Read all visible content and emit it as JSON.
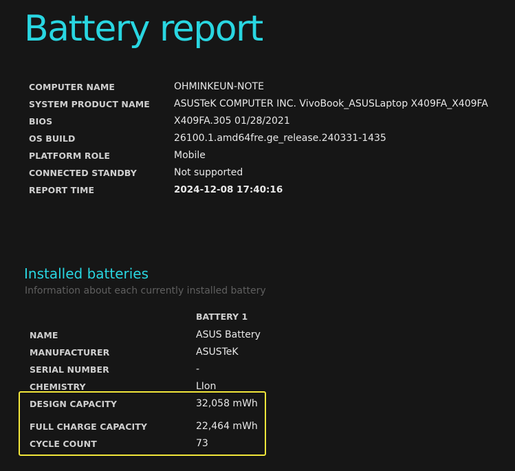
{
  "page_title": "Battery report",
  "system_info": [
    {
      "label": "COMPUTER NAME",
      "value": "OHMINKEUN-NOTE"
    },
    {
      "label": "SYSTEM PRODUCT NAME",
      "value": "ASUSTeK COMPUTER INC. VivoBook_ASUSLaptop X409FA_X409FA"
    },
    {
      "label": "BIOS",
      "value": "X409FA.305 01/28/2021"
    },
    {
      "label": "OS BUILD",
      "value": "26100.1.amd64fre.ge_release.240331-1435"
    },
    {
      "label": "PLATFORM ROLE",
      "value": "Mobile"
    },
    {
      "label": "CONNECTED STANDBY",
      "value": "Not supported"
    },
    {
      "label": "REPORT TIME",
      "value": "2024-12-08  17:40:16"
    }
  ],
  "installed_batteries": {
    "title": "Installed batteries",
    "subtitle": "Information about each currently installed battery",
    "column_header": "BATTERY 1",
    "rows": [
      {
        "label": "NAME",
        "value": "ASUS Battery"
      },
      {
        "label": "MANUFACTURER",
        "value": "ASUSTeK"
      },
      {
        "label": "SERIAL NUMBER",
        "value": "-"
      },
      {
        "label": "CHEMISTRY",
        "value": "LIon"
      },
      {
        "label": "DESIGN CAPACITY",
        "value": "32,058 mWh"
      },
      {
        "label": "FULL CHARGE CAPACITY",
        "value": "22,464 mWh"
      },
      {
        "label": "CYCLE COUNT",
        "value": "73"
      }
    ]
  },
  "colors": {
    "background": "#161616",
    "accent": "#29d6e1",
    "highlight": "#f2e63a"
  }
}
